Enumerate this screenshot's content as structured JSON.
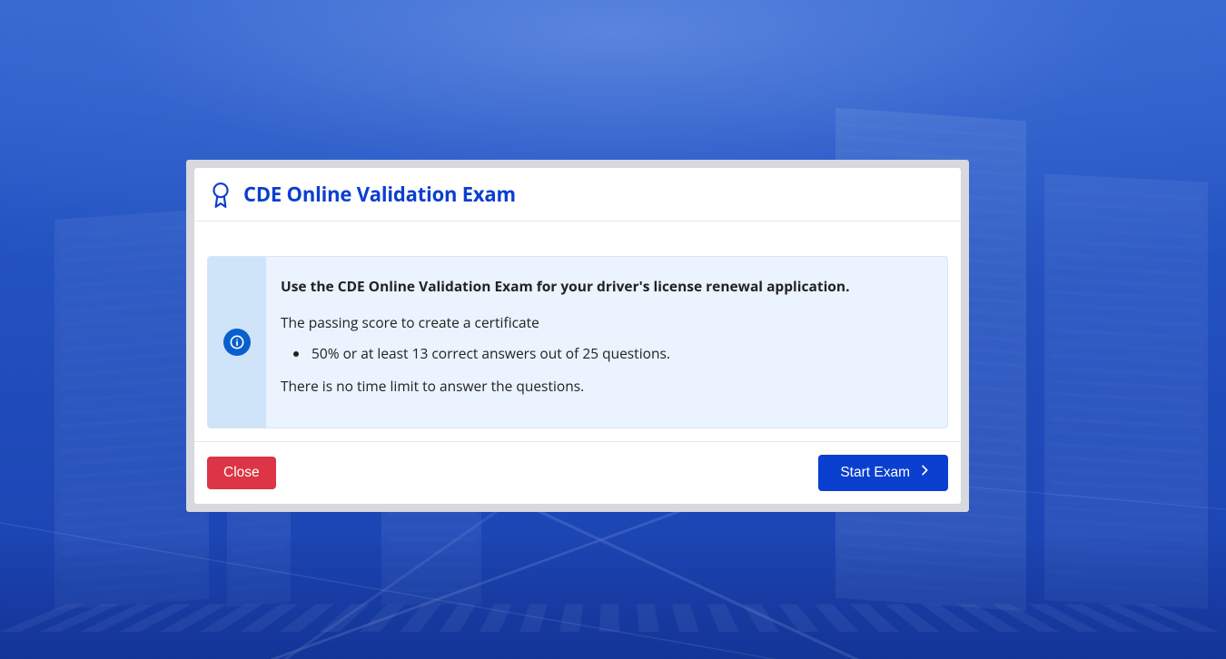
{
  "modal": {
    "title": "CDE Online Validation Exam",
    "info": {
      "lead": "Use the CDE Online Validation Exam for your driver's license renewal application.",
      "passing_intro": "The passing score to create a certificate",
      "passing_rule": "50% or at least 13 correct answers out of 25 questions.",
      "time_limit": "There is no time limit to answer the questions."
    },
    "buttons": {
      "close": "Close",
      "start": "Start Exam"
    }
  },
  "colors": {
    "brand_blue": "#0a3fcf",
    "danger_red": "#dc3545",
    "info_bg": "#eaf3fe",
    "info_stripe": "#cfe3f9"
  }
}
